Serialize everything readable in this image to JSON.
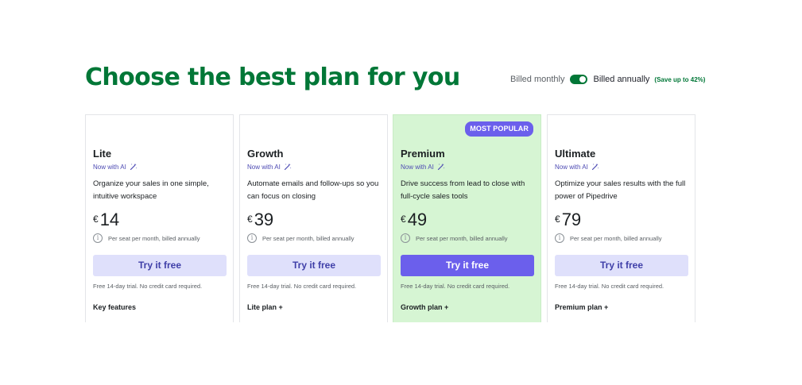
{
  "headline": "Choose the best plan for you",
  "billing": {
    "monthly_label": "Billed monthly",
    "annually_label": "Billed annually",
    "save_note": "(Save up to 42%)",
    "annual_selected": true
  },
  "colors": {
    "brand_green": "#017737",
    "accent_purple": "#6b5fec",
    "popular_bg": "#d6f5d3",
    "button_light": "#dfe0fb"
  },
  "plans": [
    {
      "name": "Lite",
      "ai_tag": "Now with AI",
      "description": "Organize your sales in one simple, intuitive workspace",
      "currency": "€",
      "price": "14",
      "price_note": "Per seat per month, billed annually",
      "cta": "Try it free",
      "trial_note": "Free 14-day trial. No credit card required.",
      "features_title": "Key features",
      "badge": ""
    },
    {
      "name": "Growth",
      "ai_tag": "Now with AI",
      "description": "Automate emails and follow-ups so you can focus on closing",
      "currency": "€",
      "price": "39",
      "price_note": "Per seat per month, billed annually",
      "cta": "Try it free",
      "trial_note": "Free 14-day trial. No credit card required.",
      "features_title": "Lite plan +",
      "badge": ""
    },
    {
      "name": "Premium",
      "ai_tag": "Now with AI",
      "description": "Drive success from lead to close with full-cycle sales tools",
      "currency": "€",
      "price": "49",
      "price_note": "Per seat per month, billed annually",
      "cta": "Try it free",
      "trial_note": "Free 14-day trial. No credit card required.",
      "features_title": "Growth plan +",
      "badge": "MOST POPULAR"
    },
    {
      "name": "Ultimate",
      "ai_tag": "Now with AI",
      "description": "Optimize your sales results with the full power of Pipedrive",
      "currency": "€",
      "price": "79",
      "price_note": "Per seat per month, billed annually",
      "cta": "Try it free",
      "trial_note": "Free 14-day trial. No credit card required.",
      "features_title": "Premium plan +",
      "badge": ""
    }
  ],
  "icons": {
    "ai": "sparkle-wand-icon",
    "info": "info-circle-icon"
  }
}
